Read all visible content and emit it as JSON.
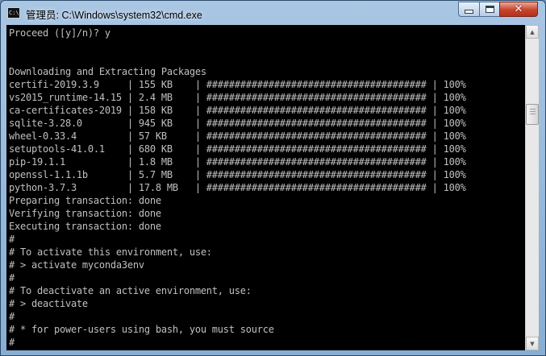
{
  "window": {
    "icon_text": "C:\\",
    "title": "管理员: C:\\Windows\\system32\\cmd.exe",
    "minimize_icon": "minimize-icon",
    "maximize_icon": "maximize-icon",
    "close_glyph": "✕"
  },
  "console": {
    "foreground": "#c0c0c0",
    "background": "#000000",
    "lines": [
      "Proceed ([y]/n)? y",
      "",
      "",
      "Downloading and Extracting Packages",
      "certifi-2019.3.9     | 155 KB    | ####################################### | 100%",
      "vs2015_runtime-14.15 | 2.4 MB    | ####################################### | 100%",
      "ca-certificates-2019 | 158 KB    | ####################################### | 100%",
      "sqlite-3.28.0        | 945 KB    | ####################################### | 100%",
      "wheel-0.33.4         | 57 KB     | ####################################### | 100%",
      "setuptools-41.0.1    | 680 KB    | ####################################### | 100%",
      "pip-19.1.1           | 1.8 MB    | ####################################### | 100%",
      "openssl-1.1.1b       | 5.7 MB    | ####################################### | 100%",
      "python-3.7.3         | 17.8 MB   | ####################################### | 100%",
      "Preparing transaction: done",
      "Verifying transaction: done",
      "Executing transaction: done",
      "#",
      "# To activate this environment, use:",
      "# > activate myconda3env",
      "#",
      "# To deactivate an active environment, use:",
      "# > deactivate",
      "#",
      "# * for power-users using bash, you must source",
      "#"
    ]
  },
  "scrollbar": {
    "up_arrow": "▲",
    "down_arrow": "▼",
    "thumb_position": 0.22,
    "thumb_size": 0.07
  }
}
